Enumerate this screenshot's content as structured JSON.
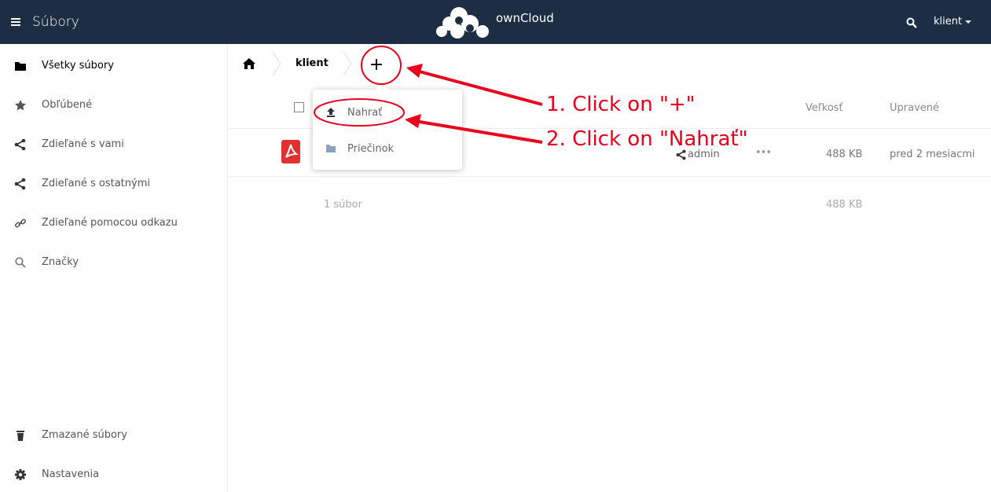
{
  "header": {
    "app_name": "Súbory",
    "brand": "ownCloud",
    "user": "klient",
    "bg_color": "#1d2d44"
  },
  "sidebar": {
    "items": [
      {
        "label": "Všetky súbory",
        "icon": "folder-icon"
      },
      {
        "label": "Obľúbené",
        "icon": "star-icon"
      },
      {
        "label": "Zdieľané s vami",
        "icon": "share-icon"
      },
      {
        "label": "Zdieľané s ostatnými",
        "icon": "share-icon"
      },
      {
        "label": "Zdieľané pomocou odkazu",
        "icon": "link-icon"
      },
      {
        "label": "Značky",
        "icon": "search-icon"
      }
    ],
    "bottom": [
      {
        "label": "Zmazané súbory",
        "icon": "trash-icon"
      },
      {
        "label": "Nastavenia",
        "icon": "gear-icon"
      }
    ]
  },
  "breadcrumb": {
    "current": "klient",
    "add_label": "+"
  },
  "table": {
    "col_size": "Veľkosť",
    "col_modified": "Upravené"
  },
  "files": [
    {
      "type": "pdf",
      "share_user": "admin",
      "size": "488 KB",
      "modified": "pred 2 mesiacmi"
    }
  ],
  "summary": {
    "count": "1 súbor",
    "size": "488 KB"
  },
  "dropdown": {
    "items": [
      {
        "label": "Nahrať",
        "icon": "upload-icon"
      },
      {
        "label": "Priečinok",
        "icon": "folder-icon"
      }
    ]
  },
  "annotations": {
    "step1": "1. Click on \"+\"",
    "step2": "2. Click on \"Nahrať\"",
    "color": "#e8001c"
  }
}
